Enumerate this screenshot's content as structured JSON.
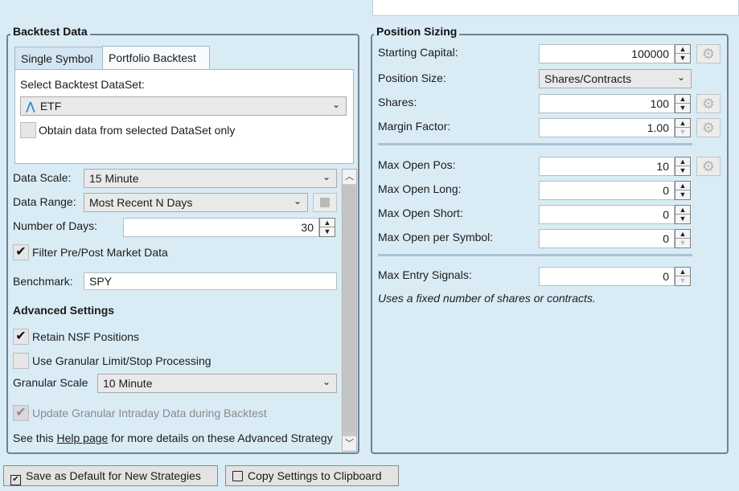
{
  "backtest": {
    "group_title": "Backtest Data",
    "tabs": [
      "Single Symbol",
      "Portfolio Backtest"
    ],
    "dataset_label": "Select Backtest DataSet:",
    "dataset_value": "ETF",
    "obtain_label": "Obtain data from selected DataSet only",
    "data_scale_label": "Data Scale:",
    "data_scale_value": "15 Minute",
    "data_range_label": "Data Range:",
    "data_range_value": "Most Recent N Days",
    "num_days_label": "Number of Days:",
    "num_days_value": "30",
    "filter_label": "Filter Pre/Post Market Data",
    "benchmark_label": "Benchmark:",
    "benchmark_value": "SPY",
    "advanced_title": "Advanced Settings",
    "retain_nsf_label": "Retain NSF Positions",
    "granular_label": "Use Granular Limit/Stop Processing",
    "granular_scale_label": "Granular Scale",
    "granular_scale_value": "10 Minute",
    "update_granular_label": "Update Granular Intraday Data during Backtest",
    "see_this": "See this",
    "help_link": "Help page",
    "see_rest": "for more details on these Advanced",
    "see_cut": "Strategy Settings"
  },
  "position": {
    "group_title": "Position Sizing",
    "starting_capital_label": "Starting Capital:",
    "starting_capital_value": "100000",
    "position_size_label": "Position Size:",
    "position_size_value": "Shares/Contracts",
    "shares_label": "Shares:",
    "shares_value": "100",
    "margin_label": "Margin Factor:",
    "margin_value": "1.00",
    "max_open_pos_label": "Max Open Pos:",
    "max_open_pos_value": "10",
    "max_open_long_label": "Max Open Long:",
    "max_open_long_value": "0",
    "max_open_short_label": "Max Open Short:",
    "max_open_short_value": "0",
    "max_open_symbol_label": "Max Open per Symbol:",
    "max_open_symbol_value": "0",
    "max_entry_label": "Max Entry Signals:",
    "max_entry_value": "0",
    "note": "Uses a fixed number of shares or contracts."
  },
  "footer": {
    "save_default": "Save as Default for New Strategies",
    "copy_settings": "Copy Settings to Clipboard"
  },
  "glyphs": {
    "check": "✔",
    "chevron": "⌄",
    "up": "▲",
    "down": "▼",
    "gear": "⚙",
    "save": "💾",
    "clipboard": "📋",
    "dataset": "⋀"
  }
}
